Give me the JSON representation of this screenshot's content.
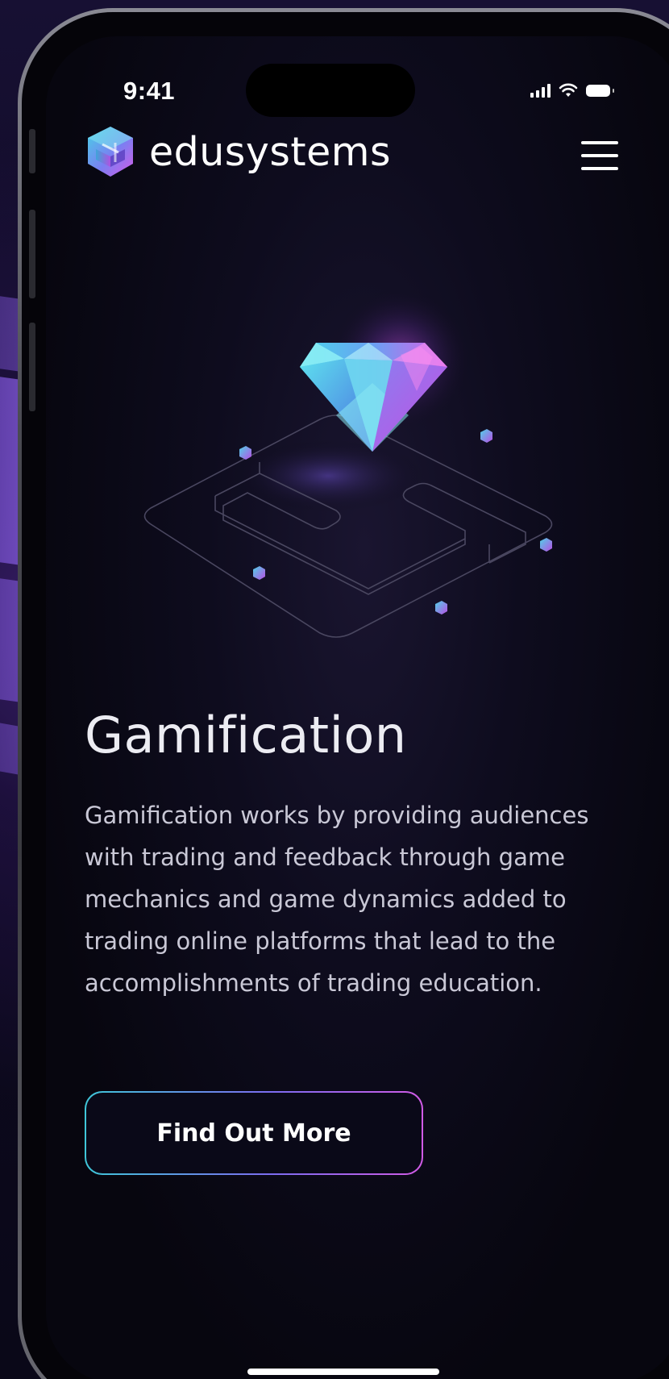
{
  "status_bar": {
    "time": "9:41",
    "icons": [
      "cellular-signal-icon",
      "wifi-icon",
      "battery-icon"
    ]
  },
  "header": {
    "brand_name": "edusystems",
    "logo_icon": "edusystems-logo-icon",
    "menu_icon": "hamburger-menu-icon"
  },
  "hero": {
    "illustration": "diamond-on-isometric-platform-illustration"
  },
  "content": {
    "title": "Gamification",
    "description": "Gamification works by providing audiences with trading and feedback through game mechanics and game dynamics added to trading online platforms that lead to the accomplishments of trading education.",
    "cta_label": "Find Out More"
  },
  "colors": {
    "background": "#07060f",
    "text": "#ffffff",
    "accent_cyan": "#3fc6d8",
    "accent_magenta": "#d15be6",
    "accent_violet": "#7c6cf0"
  }
}
